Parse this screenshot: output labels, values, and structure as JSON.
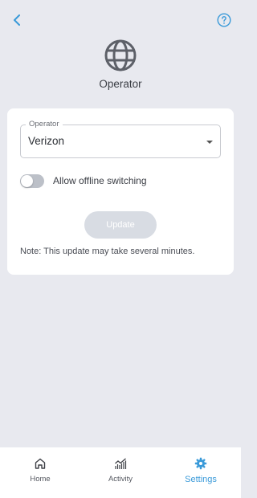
{
  "theme": {
    "accent": "#3a9ad9",
    "background": "#e8e9ef",
    "card": "#ffffff",
    "disabled_button": "#d8dce3"
  },
  "header": {
    "back_icon": "chevron-left-icon",
    "help_icon": "question-circle-icon",
    "hero_icon": "globe-icon",
    "title": "Operator"
  },
  "form": {
    "operator": {
      "label": "Operator",
      "value": "Verizon"
    },
    "offline_switching": {
      "label": "Allow offline switching",
      "enabled": false
    },
    "update_label": "Update",
    "note": "Note: This update may take several minutes."
  },
  "nav": {
    "items": [
      {
        "label": "Home",
        "icon": "home-icon",
        "active": false
      },
      {
        "label": "Activity",
        "icon": "activity-chart-icon",
        "active": false
      },
      {
        "label": "Settings",
        "icon": "gear-icon",
        "active": true
      }
    ]
  }
}
